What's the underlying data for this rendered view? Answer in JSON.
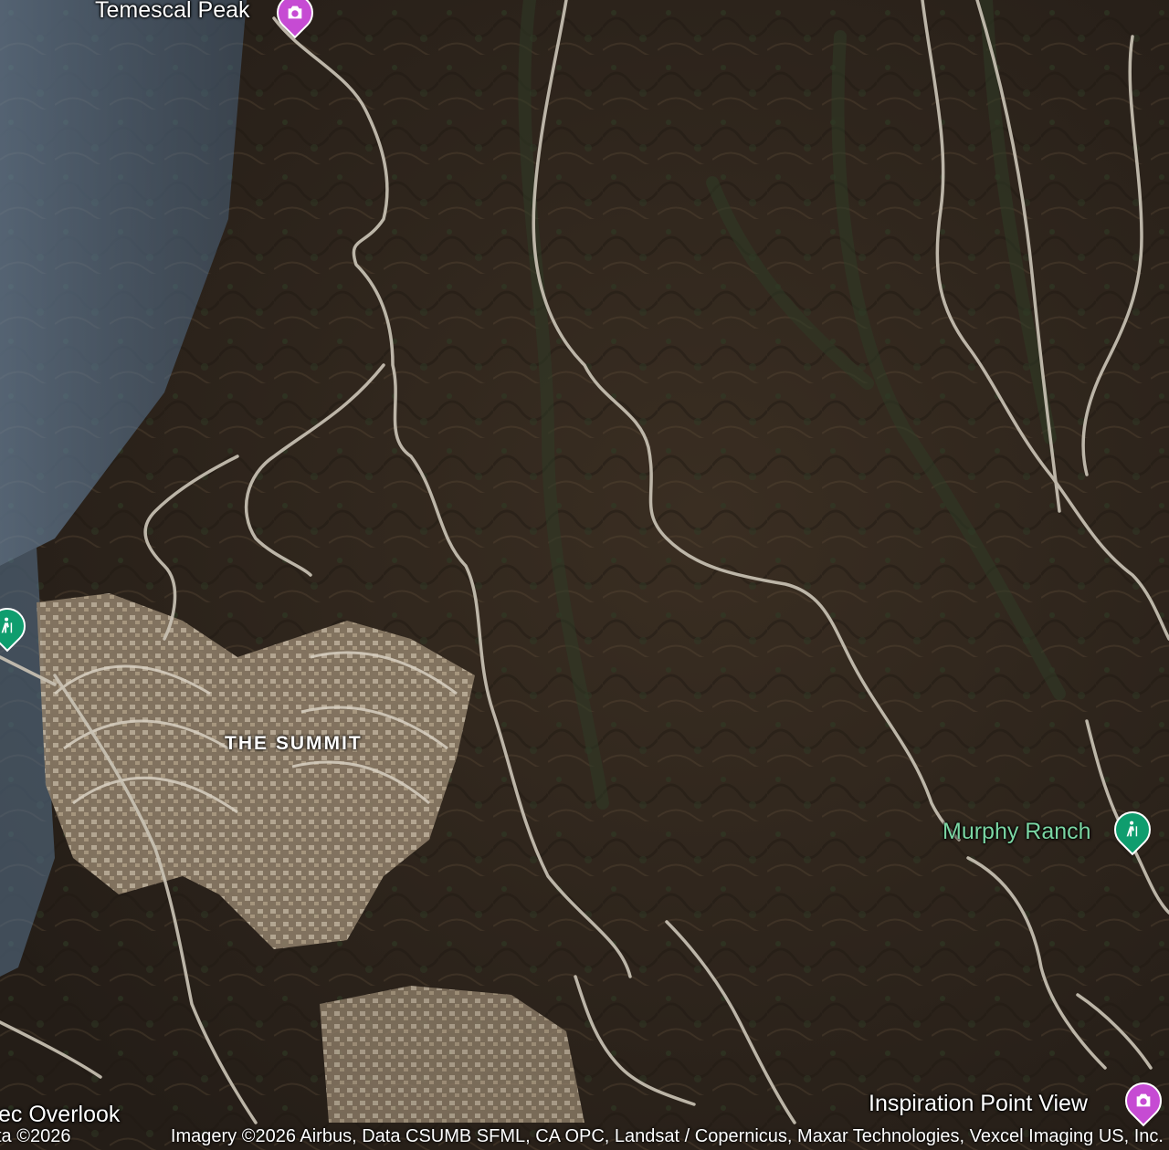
{
  "map": {
    "type": "satellite",
    "attribution": "Imagery ©2026 Airbus, Data CSUMB SFML, CA OPC, Landsat / Copernicus, Maxar Technologies, Vexcel Imaging US, Inc.",
    "attribution_prefix": "ta ©2026"
  },
  "places": [
    {
      "name": "Temescal Peak",
      "kind": "photo-spot",
      "icon": "camera-icon",
      "color": "#c64bd3"
    },
    {
      "name": "Murphy Ranch",
      "kind": "hiking-area",
      "icon": "hiker-icon",
      "color": "#0f9d6e"
    },
    {
      "name": "Inspiration Point View",
      "kind": "photo-spot",
      "icon": "camera-icon",
      "color": "#c64bd3"
    },
    {
      "name": "ec Overlook",
      "kind": "partial-label"
    }
  ],
  "areas": [
    {
      "name": "THE SUMMIT"
    }
  ],
  "left_marker": {
    "icon": "hiker-icon",
    "color": "#0f9d6e"
  },
  "colors": {
    "terrain_dark": "#2b241d",
    "terrain_mid": "#4a3b2c",
    "vegetation": "#2f3a25",
    "trail": "#c9c2b4",
    "haze_blue": "#5d7a96"
  }
}
